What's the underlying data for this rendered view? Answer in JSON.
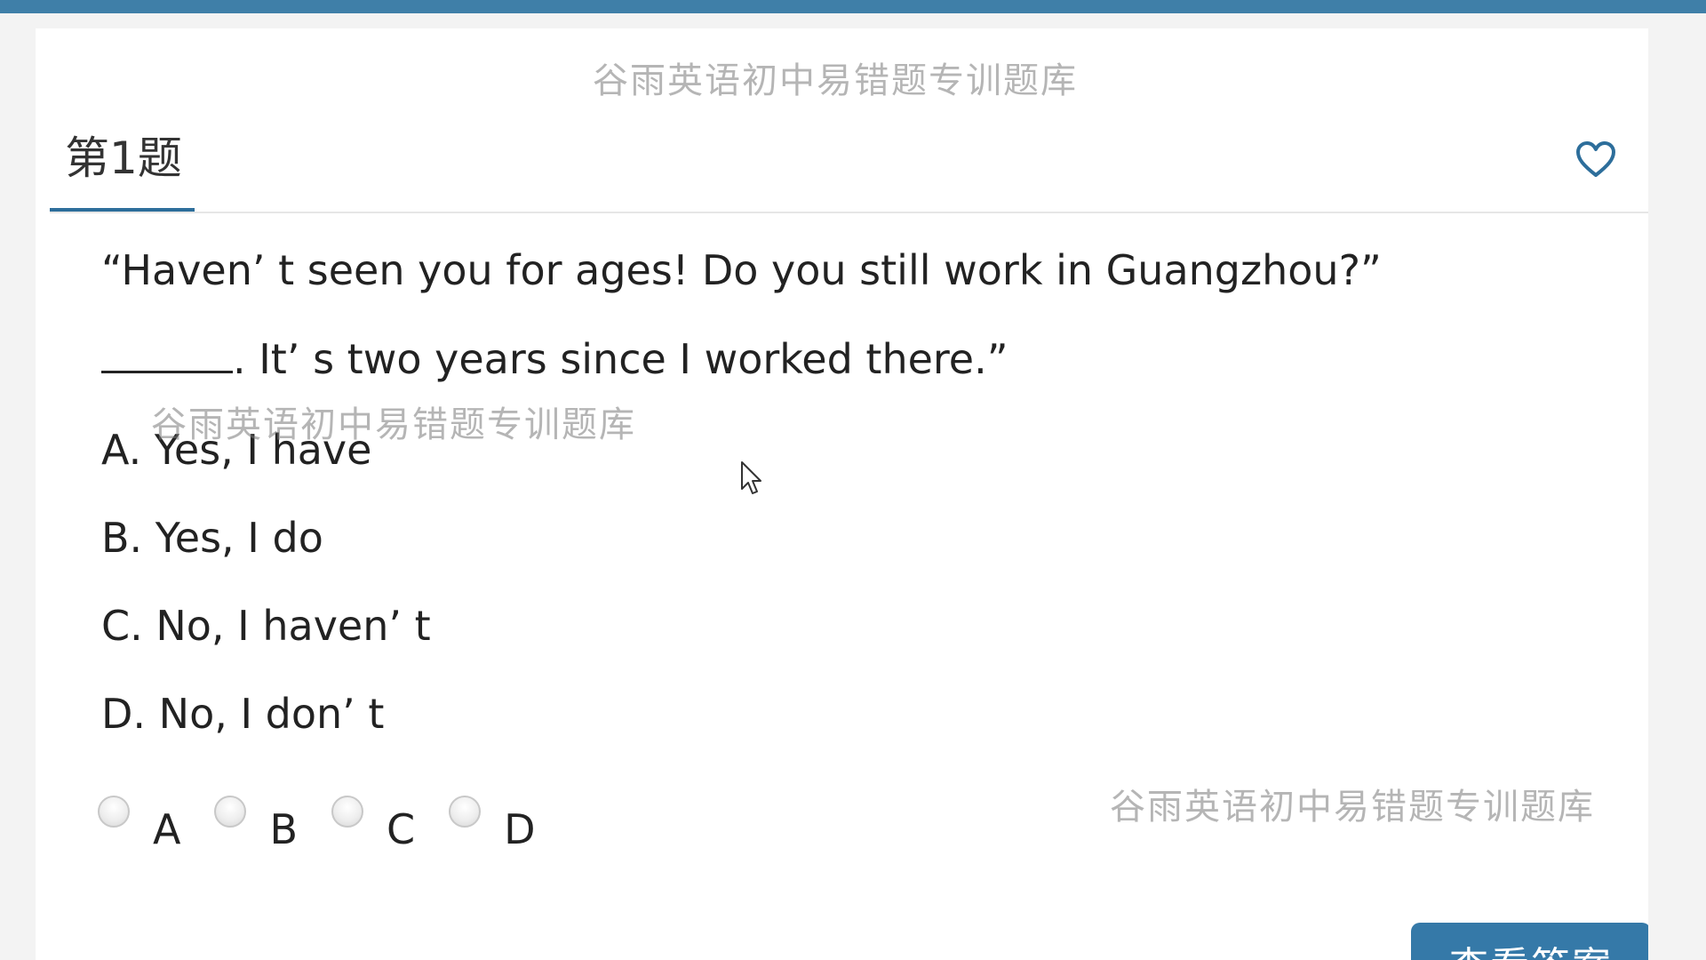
{
  "watermark": {
    "text": "谷雨英语初中易错题专训题库"
  },
  "header": {
    "question_tab_label": "第1题",
    "favorite_icon": "heart-outline-icon"
  },
  "question": {
    "line1": "“Haven’ t seen you for ages! Do you still work in Guangzhou?”",
    "line2_after_blank": ". It’ s two years since I worked there.”"
  },
  "options": [
    "A. Yes, I have",
    "B. Yes, I do",
    "C. No, I haven’ t",
    "D. No, I don’ t"
  ],
  "answer_choices": [
    "A",
    "B",
    "C",
    "D"
  ],
  "view_answer_button": {
    "label": "查看答案"
  },
  "colors": {
    "accent": "#3579a8",
    "top_bar": "#3f7fa8"
  }
}
